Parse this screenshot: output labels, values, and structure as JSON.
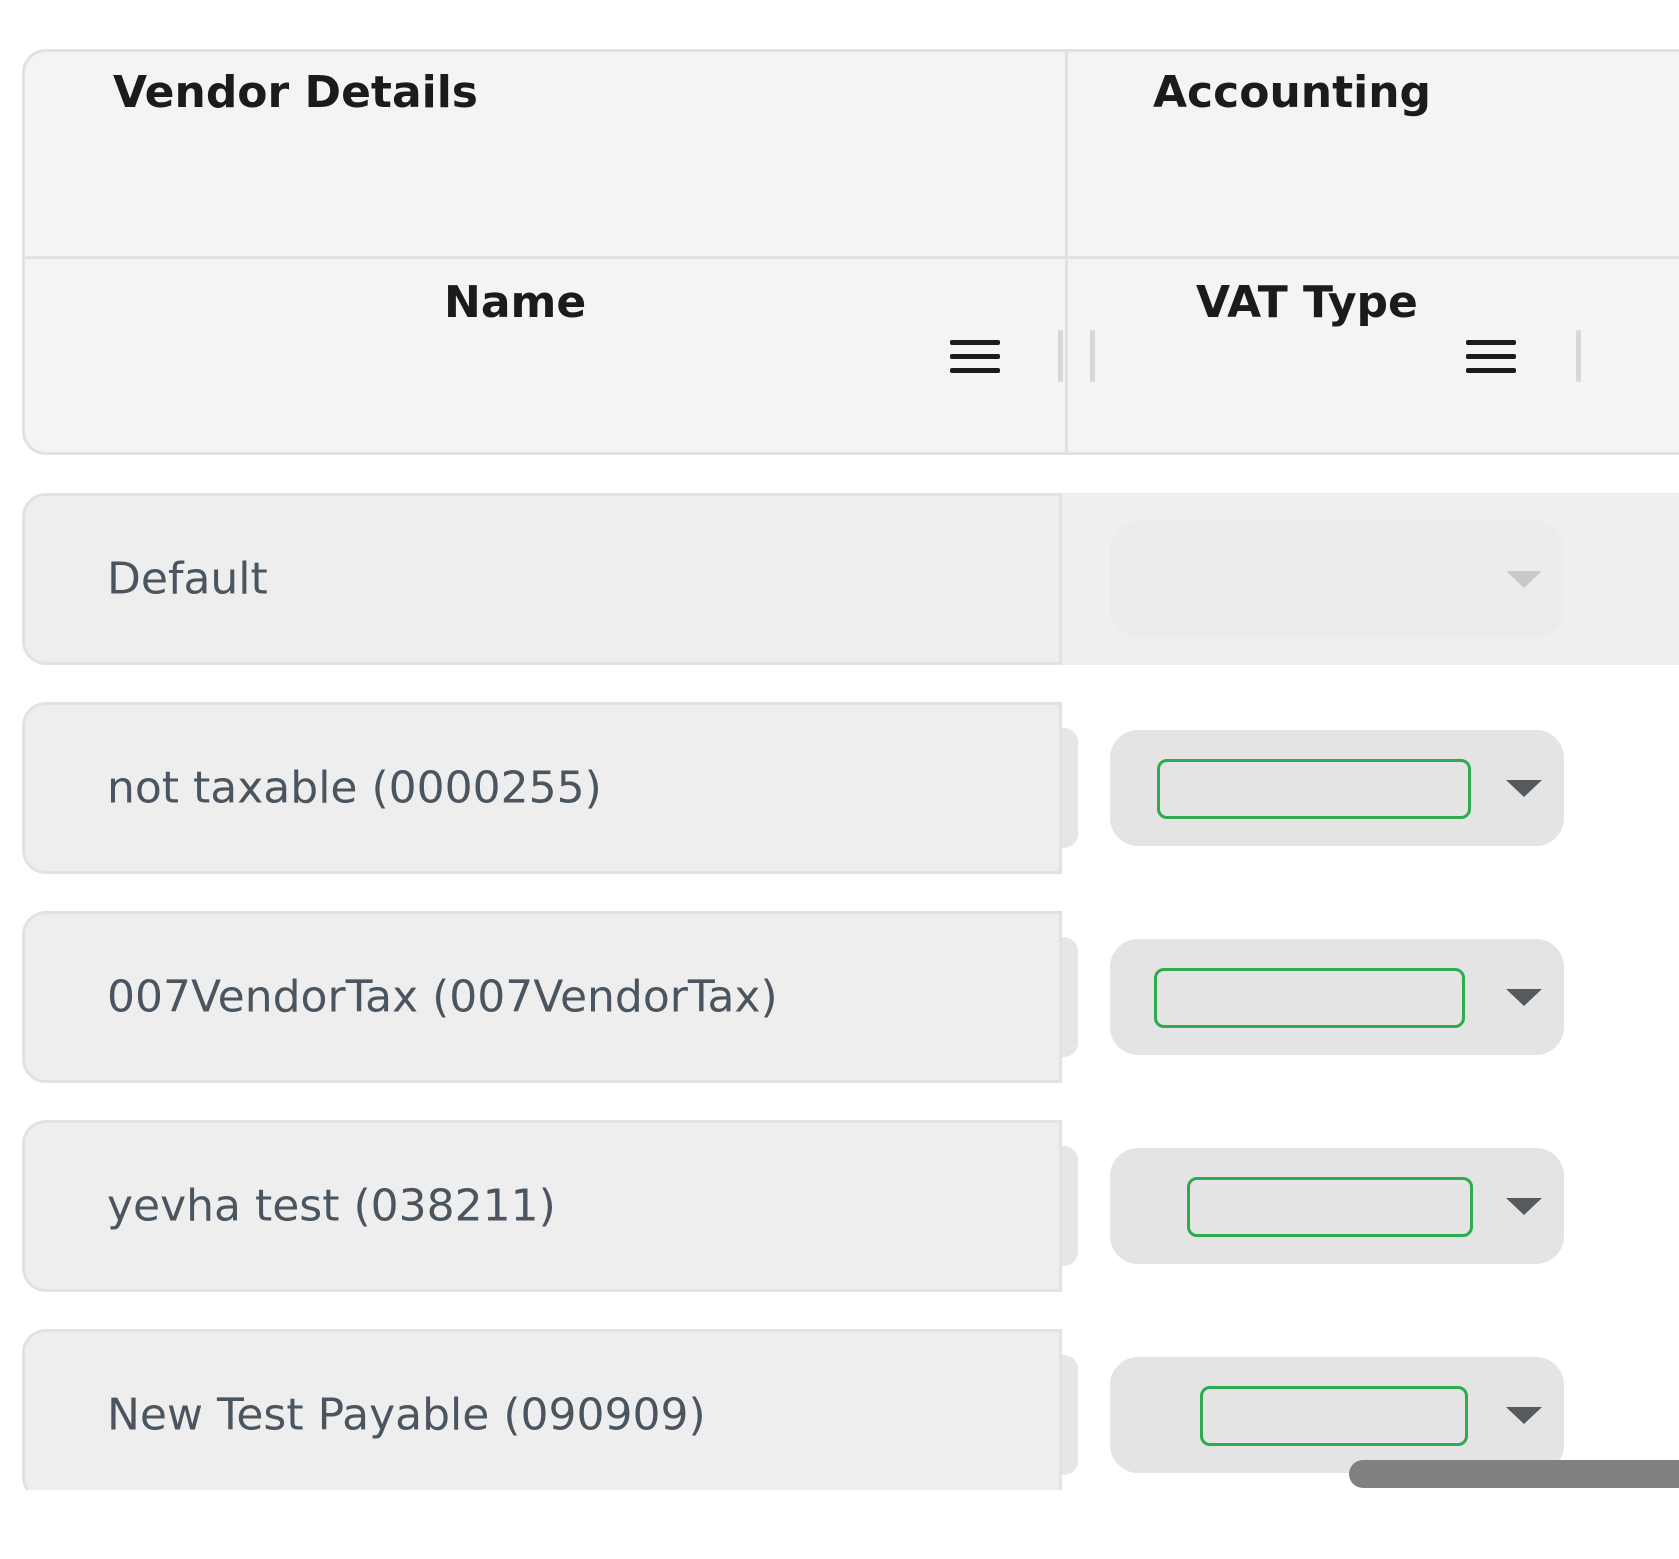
{
  "header": {
    "group_vendor_details": "Vendor Details",
    "group_accounting": "Accounting",
    "column_name": "Name",
    "column_vat_type": "VAT Type"
  },
  "rows": [
    {
      "name": "Default",
      "vat_type": "",
      "editable": false
    },
    {
      "name": "not taxable (0000255)",
      "vat_type": "",
      "editable": true
    },
    {
      "name": "007VendorTax (007VendorTax)",
      "vat_type": "",
      "editable": true
    },
    {
      "name": "yevha test (038211)",
      "vat_type": "",
      "editable": true
    },
    {
      "name": "New Test Payable (090909)",
      "vat_type": "",
      "editable": true
    }
  ],
  "colors": {
    "header_bg": "#f4f4f4",
    "cell_bg": "#eeeeee",
    "input_focus_border": "#2eaa4f",
    "name_text": "#4a5560",
    "header_text": "#1b1b1b",
    "scrollbar": "#808080"
  },
  "icons": {
    "column_menu": "hamburger-menu-icon",
    "dropdown": "caret-down-icon"
  }
}
